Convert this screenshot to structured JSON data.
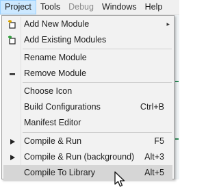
{
  "menubar": {
    "items": [
      {
        "label": "Project",
        "state": "active"
      },
      {
        "label": "Tools",
        "state": "normal"
      },
      {
        "label": "Debug",
        "state": "disabled"
      },
      {
        "label": "Windows",
        "state": "normal"
      },
      {
        "label": "Help",
        "state": "normal"
      }
    ]
  },
  "project_menu": {
    "add_new_module": {
      "label": "Add New Module",
      "icon": "add-new-module-icon",
      "submenu": "▸"
    },
    "add_existing_modules": {
      "label": "Add Existing Modules",
      "icon": "add-existing-modules-icon"
    },
    "rename_module": {
      "label": "Rename Module"
    },
    "remove_module": {
      "label": "Remove Module",
      "icon": "minus-icon"
    },
    "choose_icon": {
      "label": "Choose Icon"
    },
    "build_configurations": {
      "label": "Build Configurations",
      "shortcut": "Ctrl+B"
    },
    "manifest_editor": {
      "label": "Manifest Editor"
    },
    "compile_run": {
      "label": "Compile & Run",
      "shortcut": "F5",
      "icon": "play-icon"
    },
    "compile_run_background": {
      "label": "Compile & Run (background)",
      "shortcut": "Alt+3",
      "icon": "play-icon"
    },
    "compile_to_library": {
      "label": "Compile To Library",
      "shortcut": "Alt+5",
      "state": "hovered"
    }
  },
  "colors": {
    "menubar_bg": "#f0f0f0",
    "active_top_bg": "#cce8ff",
    "menu_bg": "#f2f2f2",
    "hover_bg": "#d6d6d6",
    "disabled_text": "#8a8a8a"
  }
}
